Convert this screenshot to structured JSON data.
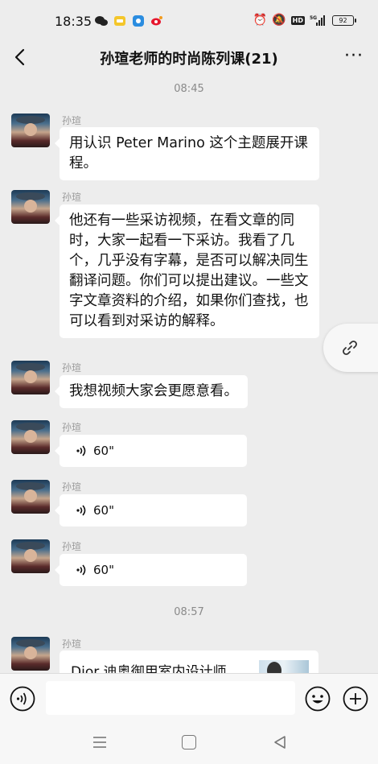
{
  "status_bar": {
    "time": "18:35",
    "left_icons": [
      "wechat-icon",
      "notes-icon",
      "browser-icon",
      "weibo-icon"
    ],
    "right_icons": [
      "alarm-icon",
      "mute-icon",
      "hd-icon",
      "5g-signal-icon",
      "battery-icon"
    ],
    "hd": "HD",
    "network": "5G",
    "battery": "92"
  },
  "nav": {
    "back_icon": "chevron-left-icon",
    "title": "孙瑄老师的时尚陈列课(21)",
    "more": "···"
  },
  "chat": {
    "timestamps": [
      "08:45",
      "08:57"
    ],
    "messages": [
      {
        "sender": "孙瑄",
        "type": "text",
        "text": "用认识 Peter Marino 这个主题展开课程。"
      },
      {
        "sender": "孙瑄",
        "type": "text",
        "text": "他还有一些采访视频，在看文章的同时，大家一起看一下采访。我看了几个，几乎没有字幕，是否可以解决同生翻译问题。你们可以提出建议。一些文字文章资料的介绍，如果你们查找，也可以看到对采访的解释。"
      },
      {
        "sender": "孙瑄",
        "type": "text",
        "text": "我想视频大家会更愿意看。"
      },
      {
        "sender": "孙瑄",
        "type": "voice",
        "duration": "60\""
      },
      {
        "sender": "孙瑄",
        "type": "voice",
        "duration": "60\""
      },
      {
        "sender": "孙瑄",
        "type": "voice",
        "duration": "60\""
      },
      {
        "sender": "孙瑄",
        "type": "card",
        "text": "Dior 迪奥御用室内设计师"
      }
    ],
    "float_button_icon": "link-icon"
  },
  "input_bar": {
    "voice_icon": "voice-input-icon",
    "placeholder": "",
    "emoji_icon": "emoji-icon",
    "plus_icon": "plus-circle-icon"
  },
  "system_nav": {
    "menu_icon": "menu-icon",
    "home_icon": "home-square-icon",
    "back_icon": "back-triangle-icon"
  }
}
